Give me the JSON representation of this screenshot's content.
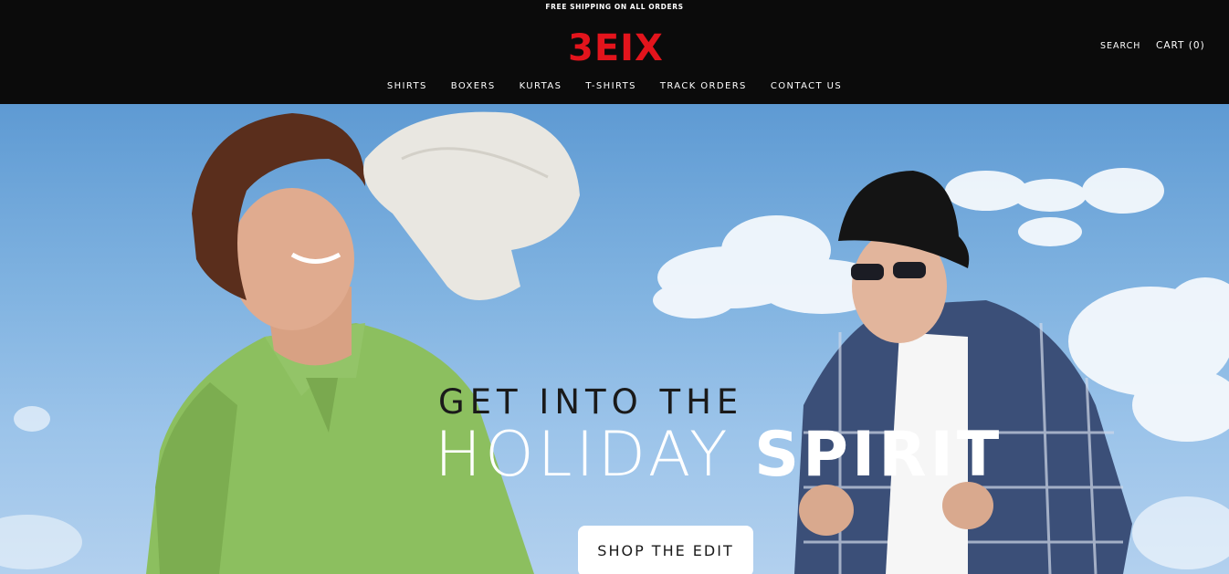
{
  "announcement": "FREE SHIPPING ON ALL ORDERS",
  "brand": {
    "logo_text": "3EIX",
    "color": "#e3141c"
  },
  "utility": {
    "search": "SEARCH",
    "cart": "CART (0)"
  },
  "nav": [
    "SHIRTS",
    "BOXERS",
    "KURTAS",
    "T-SHIRTS",
    "TRACK ORDERS",
    "CONTACT US"
  ],
  "hero": {
    "line1": "GET INTO THE",
    "line2_regular": "HOLIDAY ",
    "line2_bold": "SPIRIT",
    "cta": "SHOP THE EDIT"
  },
  "colors": {
    "header_bg": "#0b0b0b",
    "sky": "#7fb2e0"
  }
}
